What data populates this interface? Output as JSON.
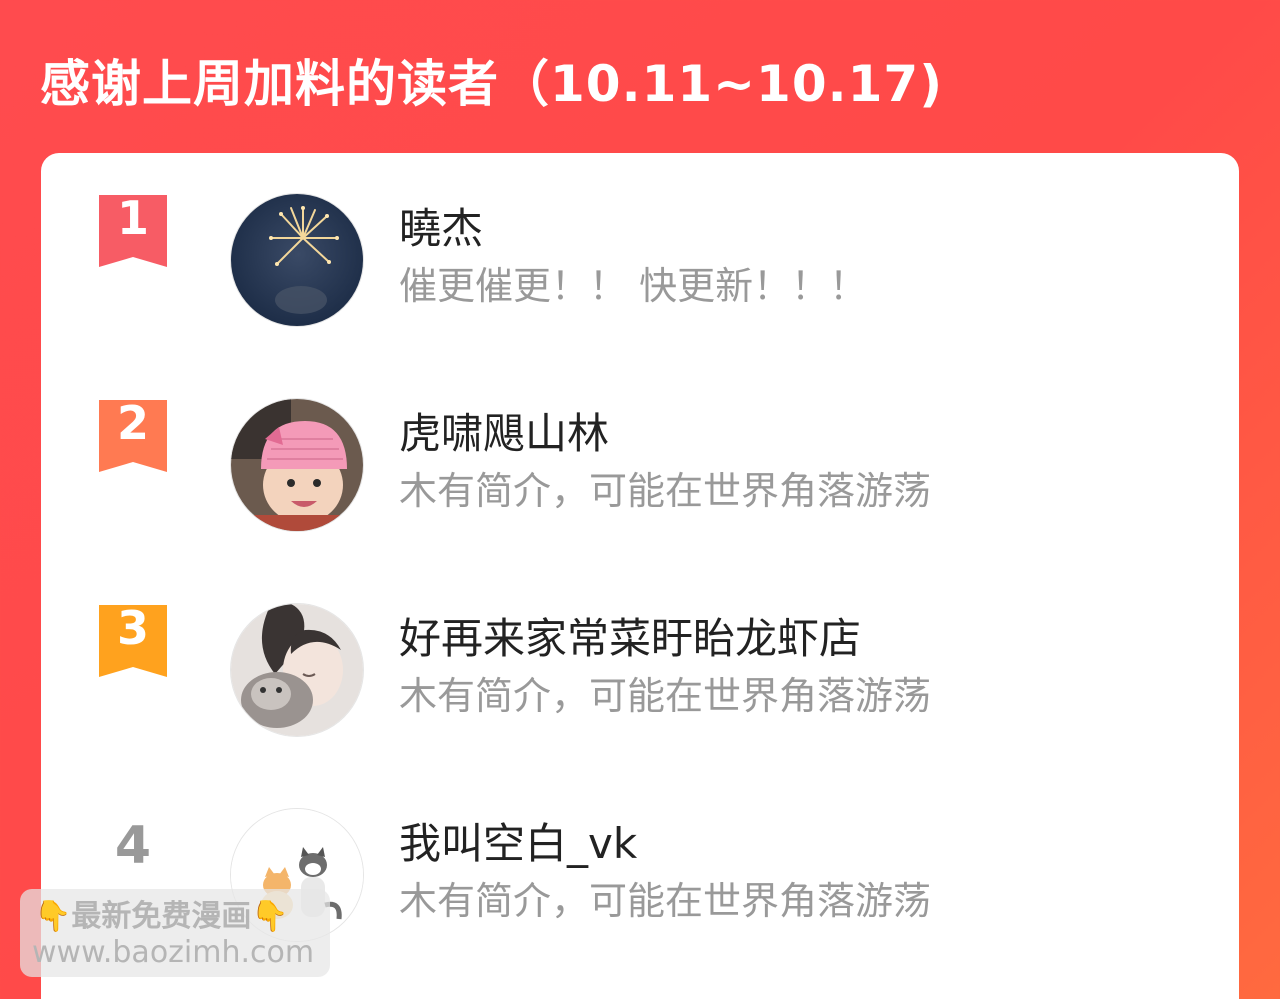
{
  "header": {
    "title": "感谢上周加料的读者（10.11~10.17)"
  },
  "readers": [
    {
      "rank": "1",
      "name": "曉杰",
      "bio": "催更催更！！ 快更新！！！",
      "badge_color": "#f75c65",
      "avatar": "fireworks-avatar"
    },
    {
      "rank": "2",
      "name": "虎啸飓山林",
      "bio": "木有简介，可能在世界角落游荡",
      "badge_color": "#ff7a52",
      "avatar": "baby-avatar"
    },
    {
      "rank": "3",
      "name": "好再来家常菜盱眙龙虾店",
      "bio": "木有简介，可能在世界角落游荡",
      "badge_color": "#ffa21e",
      "avatar": "person-with-cat-avatar"
    },
    {
      "rank": "4",
      "name": "我叫空白_vk",
      "bio": "木有简介，可能在世界角落游荡",
      "badge_color": "#999999",
      "avatar": "cartoon-pets-avatar"
    }
  ],
  "watermark": {
    "line1": "最新免费漫画",
    "line2": "www.baozimh.com",
    "hand_glyph": "👇"
  },
  "colors": {
    "background": "#ff4b4e",
    "card": "#ffffff",
    "name_text": "#222222",
    "bio_text": "#999999"
  }
}
